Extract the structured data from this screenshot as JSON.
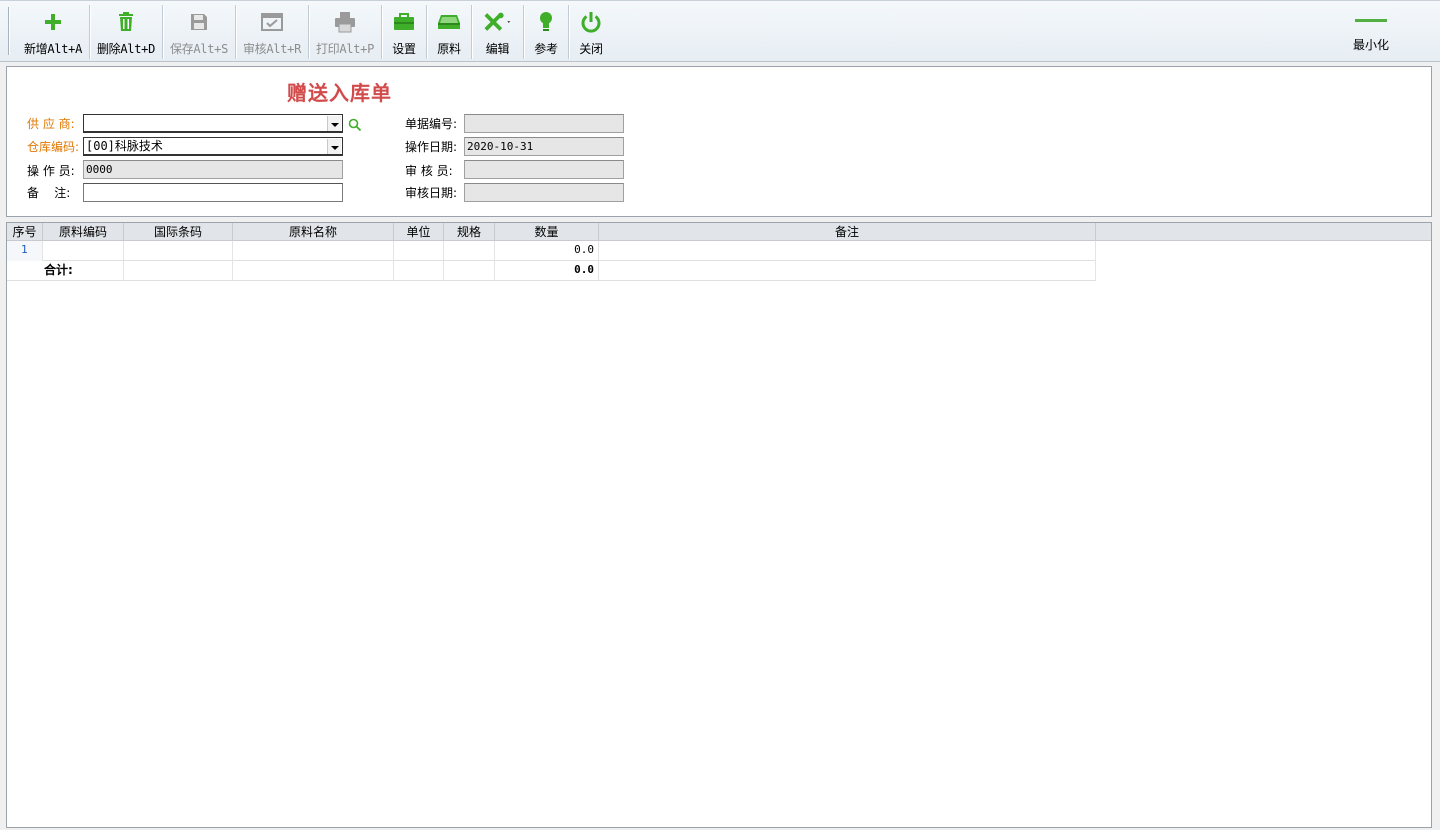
{
  "toolbar": {
    "buttons": [
      {
        "label": "新增Alt+A",
        "icon": "plus-icon",
        "enabled": true
      },
      {
        "label": "删除Alt+D",
        "icon": "trash-icon",
        "enabled": true
      },
      {
        "label": "保存Alt+S",
        "icon": "save-icon",
        "enabled": false
      },
      {
        "label": "审核Alt+R",
        "icon": "audit-icon",
        "enabled": false
      },
      {
        "label": "打印Alt+P",
        "icon": "printer-icon",
        "enabled": false
      },
      {
        "label": "设置",
        "icon": "toolbox-icon",
        "enabled": true
      },
      {
        "label": "原料",
        "icon": "material-icon",
        "enabled": true
      },
      {
        "label": "编辑",
        "icon": "tools-icon",
        "enabled": true
      },
      {
        "label": "参考",
        "icon": "lightbulb-icon",
        "enabled": true
      },
      {
        "label": "关闭",
        "icon": "power-icon",
        "enabled": true
      }
    ],
    "minimize_label": "最小化"
  },
  "form": {
    "title": "赠送入库单",
    "supplier_label": "供 应 商:",
    "supplier_value": "",
    "warehouse_label": "仓库编码:",
    "warehouse_value": "[00]科脉技术",
    "operator_label": "操 作 员:",
    "operator_value": "0000",
    "remark_label": "备    注:",
    "remark_value": "",
    "doc_no_label": "单据编号:",
    "doc_no_value": "",
    "op_date_label": "操作日期:",
    "op_date_value": "2020-10-31",
    "auditor_label": "审 核 员:",
    "auditor_value": "",
    "audit_date_label": "审核日期:",
    "audit_date_value": ""
  },
  "grid": {
    "columns": [
      "序号",
      "原料编码",
      "国际条码",
      "原料名称",
      "单位",
      "规格",
      "数量",
      "备注"
    ],
    "rows": [
      {
        "index": "1",
        "code": "",
        "barcode": "",
        "name": "",
        "unit": "",
        "spec": "",
        "qty": "0.0",
        "remark": ""
      }
    ],
    "total_label": "合计:",
    "total_qty": "0.0"
  },
  "colors": {
    "accent_green": "#52b043",
    "title_red": "#d24a4a",
    "required_orange": "#e07800"
  }
}
